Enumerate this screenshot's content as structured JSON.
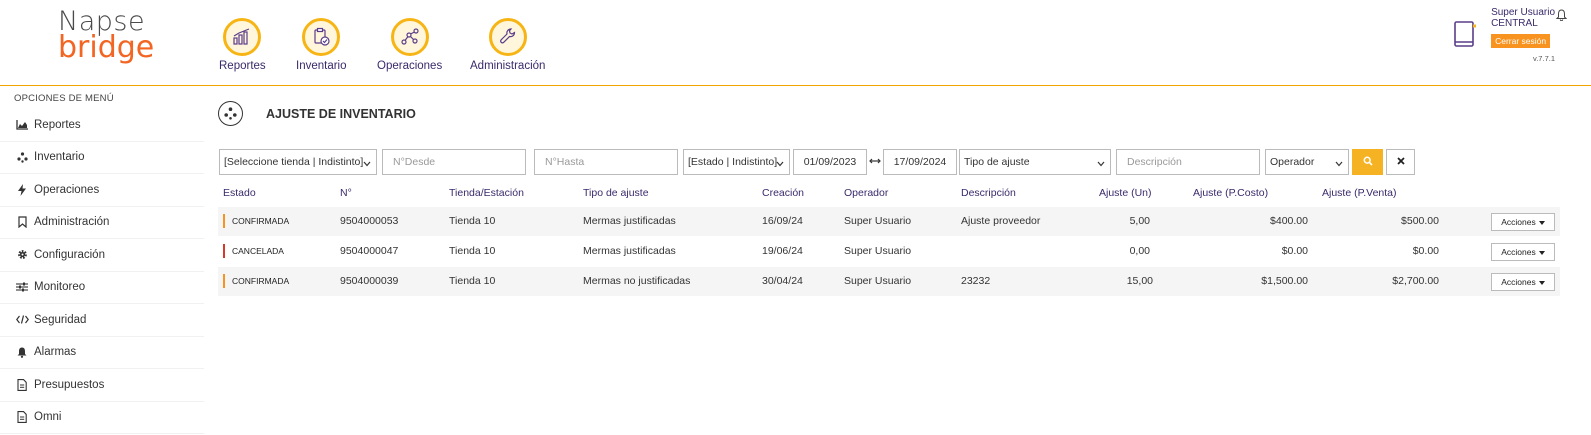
{
  "logo": {
    "line1": "Napse",
    "line2": "bridge"
  },
  "modules": [
    {
      "label": "Reportes"
    },
    {
      "label": "Inventario"
    },
    {
      "label": "Operaciones"
    },
    {
      "label": "Administración"
    }
  ],
  "user": {
    "name_line1": "Super Usuario",
    "name_line2": "CENTRAL",
    "logout": "Cerrar sesión",
    "version": "v.7.7.1"
  },
  "sidebar": {
    "title": "OPCIONES DE MENÚ",
    "items": [
      {
        "label": "Reportes",
        "icon": "chart-icon"
      },
      {
        "label": "Inventario",
        "icon": "inventory-icon"
      },
      {
        "label": "Operaciones",
        "icon": "bolt-icon"
      },
      {
        "label": "Administración",
        "icon": "bookmark-icon"
      },
      {
        "label": "Configuración",
        "icon": "gear-icon"
      },
      {
        "label": "Monitoreo",
        "icon": "sliders-icon"
      },
      {
        "label": "Seguridad",
        "icon": "code-icon"
      },
      {
        "label": "Alarmas",
        "icon": "bell-icon"
      },
      {
        "label": "Presupuestos",
        "icon": "document-icon"
      },
      {
        "label": "Omni",
        "icon": "document-icon"
      }
    ]
  },
  "page": {
    "title": "AJUSTE DE INVENTARIO"
  },
  "filters": {
    "store": "[Seleccione tienda | Indistinto]",
    "from_placeholder": "N°Desde",
    "to_placeholder": "N°Hasta",
    "state": "[Estado | Indistinto]",
    "date_from": "01/09/2023",
    "date_to": "17/09/2024",
    "adjust_type": "Tipo de ajuste",
    "description_placeholder": "Descripción",
    "operator": "Operador"
  },
  "table": {
    "headers": [
      "Estado",
      "N°",
      "Tienda/Estación",
      "Tipo de ajuste",
      "Creación",
      "Operador",
      "Descripción",
      "Ajuste (Un)",
      "Ajuste (P.Costo)",
      "Ajuste (P.Venta)"
    ],
    "rows": [
      {
        "estado": "CONFIRMADA",
        "numero": "9504000053",
        "tienda": "Tienda 10",
        "tipo": "Mermas justificadas",
        "creacion": "16/09/24",
        "operador": "Super Usuario",
        "descripcion": "Ajuste proveedor",
        "un": "5,00",
        "costo": "$400.00",
        "venta": "$500.00",
        "acciones": "Acciones"
      },
      {
        "estado": "CANCELADA",
        "numero": "9504000047",
        "tienda": "Tienda 10",
        "tipo": "Mermas justificadas",
        "creacion": "19/06/24",
        "operador": "Super Usuario",
        "descripcion": "",
        "un": "0,00",
        "costo": "$0.00",
        "venta": "$0.00",
        "acciones": "Acciones"
      },
      {
        "estado": "CONFIRMADA",
        "numero": "9504000039",
        "tienda": "Tienda 10",
        "tipo": "Mermas no justificadas",
        "creacion": "30/04/24",
        "operador": "Super Usuario",
        "descripcion": "23232",
        "un": "15,00",
        "costo": "$1,500.00",
        "venta": "$2,700.00",
        "acciones": "Acciones"
      }
    ]
  },
  "colors": {
    "accent": "#f7b515",
    "orange": "#f7931e",
    "purple": "#3b2a6b",
    "cancel": "#d63a2a"
  }
}
